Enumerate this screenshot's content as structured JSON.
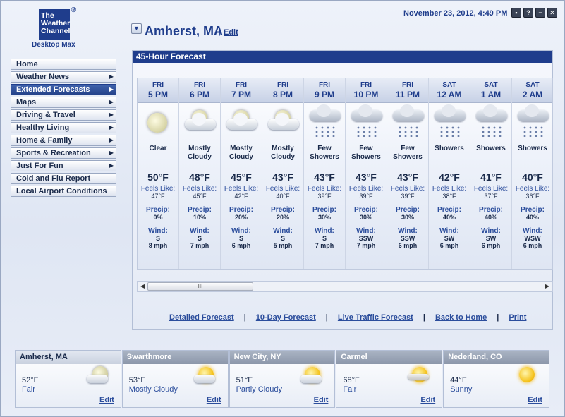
{
  "app": {
    "logo_line1": "The",
    "logo_line2": "Weather",
    "logo_line3": "Channel",
    "logo_reg": "®",
    "logo_sub": "Desktop Max",
    "datetime": "November 23, 2012, 4:49 PM",
    "window_buttons": [
      "▪",
      "?",
      "−",
      "✕"
    ]
  },
  "location": {
    "name": "Amherst, MA",
    "separator": "|",
    "edit_label": "Edit",
    "dropdown_glyph": "▼"
  },
  "sidebar": {
    "items": [
      {
        "label": "Home",
        "arrow": "",
        "active": false
      },
      {
        "label": "Weather News",
        "arrow": "▶",
        "active": false
      },
      {
        "label": "Extended Forecasts",
        "arrow": "▶",
        "active": true
      },
      {
        "label": "Maps",
        "arrow": "▶",
        "active": false
      },
      {
        "label": "Driving & Travel",
        "arrow": "▶",
        "active": false
      },
      {
        "label": "Healthy Living",
        "arrow": "▶",
        "active": false
      },
      {
        "label": "Home & Family",
        "arrow": "▶",
        "active": false
      },
      {
        "label": "Sports & Recreation",
        "arrow": "▶",
        "active": false
      },
      {
        "label": "Just For Fun",
        "arrow": "▶",
        "active": false
      },
      {
        "label": "Cold and Flu Report",
        "arrow": "",
        "active": false
      },
      {
        "label": "Local Airport Conditions",
        "arrow": "",
        "active": false
      }
    ]
  },
  "forecast": {
    "title": "45-Hour Forecast",
    "feels_label": "Feels Like:",
    "precip_label": "Precip:",
    "wind_label": "Wind:",
    "columns": [
      {
        "day": "FRI",
        "time": "5 PM",
        "icon": "moon-icon",
        "desc": "Clear",
        "temp": "50°F",
        "feels": "47°F",
        "precip": "0%",
        "wind_dir": "S",
        "wind_speed": "8 mph"
      },
      {
        "day": "FRI",
        "time": "6 PM",
        "icon": "moon-cloud-icon",
        "desc": "Mostly Cloudy",
        "temp": "48°F",
        "feels": "45°F",
        "precip": "10%",
        "wind_dir": "S",
        "wind_speed": "7 mph"
      },
      {
        "day": "FRI",
        "time": "7 PM",
        "icon": "moon-cloud-icon",
        "desc": "Mostly Cloudy",
        "temp": "45°F",
        "feels": "42°F",
        "precip": "20%",
        "wind_dir": "S",
        "wind_speed": "6 mph"
      },
      {
        "day": "FRI",
        "time": "8 PM",
        "icon": "moon-cloud-icon",
        "desc": "Mostly Cloudy",
        "temp": "43°F",
        "feels": "40°F",
        "precip": "20%",
        "wind_dir": "S",
        "wind_speed": "5 mph"
      },
      {
        "day": "FRI",
        "time": "9 PM",
        "icon": "rain-cloud-icon",
        "desc": "Few Showers",
        "temp": "43°F",
        "feels": "39°F",
        "precip": "30%",
        "wind_dir": "S",
        "wind_speed": "7 mph"
      },
      {
        "day": "FRI",
        "time": "10 PM",
        "icon": "rain-cloud-icon",
        "desc": "Few Showers",
        "temp": "43°F",
        "feels": "39°F",
        "precip": "30%",
        "wind_dir": "SSW",
        "wind_speed": "7 mph"
      },
      {
        "day": "FRI",
        "time": "11 PM",
        "icon": "rain-cloud-icon",
        "desc": "Few Showers",
        "temp": "43°F",
        "feels": "39°F",
        "precip": "30%",
        "wind_dir": "SSW",
        "wind_speed": "6 mph"
      },
      {
        "day": "SAT",
        "time": "12 AM",
        "icon": "rain-cloud-icon",
        "desc": "Showers",
        "temp": "42°F",
        "feels": "38°F",
        "precip": "40%",
        "wind_dir": "SW",
        "wind_speed": "6 mph"
      },
      {
        "day": "SAT",
        "time": "1 AM",
        "icon": "rain-cloud-icon",
        "desc": "Showers",
        "temp": "41°F",
        "feels": "37°F",
        "precip": "40%",
        "wind_dir": "SW",
        "wind_speed": "6 mph"
      },
      {
        "day": "SAT",
        "time": "2 AM",
        "icon": "rain-cloud-icon",
        "desc": "Showers",
        "temp": "40°F",
        "feels": "36°F",
        "precip": "40%",
        "wind_dir": "WSW",
        "wind_speed": "6 mph"
      }
    ],
    "scrollbar": {
      "left": "◀",
      "right": "▶",
      "thumb": "III"
    },
    "links": [
      "Detailed Forecast",
      "10-Day Forecast",
      "Live Traffic Forecast",
      "Back to Home",
      "Print"
    ],
    "link_separator": "|"
  },
  "cities": [
    {
      "name": "Amherst, MA",
      "temp": "52°F",
      "cond": "Fair",
      "icon": "moon-cloud-icon",
      "edit": "Edit"
    },
    {
      "name": "Swarthmore",
      "temp": "53°F",
      "cond": "Mostly Cloudy",
      "icon": "sun-cloud-icon",
      "edit": "Edit"
    },
    {
      "name": "New City, NY",
      "temp": "51°F",
      "cond": "Partly Cloudy",
      "icon": "sun-cloud-icon",
      "edit": "Edit"
    },
    {
      "name": "Carmel",
      "temp": "68°F",
      "cond": "Fair",
      "icon": "sun-haze-icon",
      "edit": "Edit"
    },
    {
      "name": "Nederland, CO",
      "temp": "44°F",
      "cond": "Sunny",
      "icon": "sun-icon",
      "edit": "Edit"
    }
  ]
}
